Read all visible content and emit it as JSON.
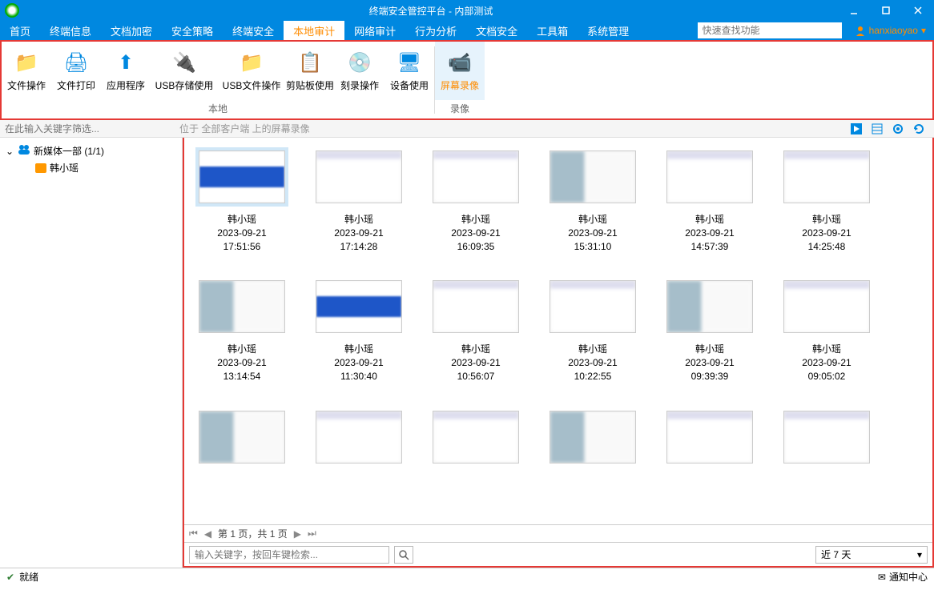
{
  "window": {
    "title": "终端安全管控平台 - 内部测试"
  },
  "menu": {
    "tabs": [
      "首页",
      "终端信息",
      "文档加密",
      "安全策略",
      "终端安全",
      "本地审计",
      "网络审计",
      "行为分析",
      "文档安全",
      "工具箱",
      "系统管理"
    ],
    "active_index": 5,
    "search_placeholder": "快速查找功能",
    "user": "hanxiaoyao"
  },
  "ribbon": {
    "group1_label": "本地",
    "group2_label": "录像",
    "items": [
      "文件操作",
      "文件打印",
      "应用程序",
      "USB存储使用",
      "USB文件操作",
      "剪贴板使用",
      "刻录操作",
      "设备使用",
      "屏幕录像"
    ],
    "active_index": 8
  },
  "filter": {
    "placeholder": "在此输入关键字筛选...",
    "breadcrumb": "位于 全部客户端 上的屏幕录像"
  },
  "tree": {
    "group": "新媒体一部 (1/1)",
    "leaf": "韩小瑶"
  },
  "recordings": [
    {
      "user": "韩小瑶",
      "date": "2023-09-21",
      "time": "17:51:56",
      "thumb": "t1",
      "selected": true
    },
    {
      "user": "韩小瑶",
      "date": "2023-09-21",
      "time": "17:14:28",
      "thumb": "t2"
    },
    {
      "user": "韩小瑶",
      "date": "2023-09-21",
      "time": "16:09:35",
      "thumb": "t2"
    },
    {
      "user": "韩小瑶",
      "date": "2023-09-21",
      "time": "15:31:10",
      "thumb": "t3"
    },
    {
      "user": "韩小瑶",
      "date": "2023-09-21",
      "time": "14:57:39",
      "thumb": "t2"
    },
    {
      "user": "韩小瑶",
      "date": "2023-09-21",
      "time": "14:25:48",
      "thumb": "t2"
    },
    {
      "user": "韩小瑶",
      "date": "2023-09-21",
      "time": "13:14:54",
      "thumb": "t3"
    },
    {
      "user": "韩小瑶",
      "date": "2023-09-21",
      "time": "11:30:40",
      "thumb": "t1"
    },
    {
      "user": "韩小瑶",
      "date": "2023-09-21",
      "time": "10:56:07",
      "thumb": "t2"
    },
    {
      "user": "韩小瑶",
      "date": "2023-09-21",
      "time": "10:22:55",
      "thumb": "t2"
    },
    {
      "user": "韩小瑶",
      "date": "2023-09-21",
      "time": "09:39:39",
      "thumb": "t3"
    },
    {
      "user": "韩小瑶",
      "date": "2023-09-21",
      "time": "09:05:02",
      "thumb": "t2"
    },
    {
      "user": "",
      "date": "",
      "time": "",
      "thumb": "t3"
    },
    {
      "user": "",
      "date": "",
      "time": "",
      "thumb": "t2"
    },
    {
      "user": "",
      "date": "",
      "time": "",
      "thumb": "t2"
    },
    {
      "user": "",
      "date": "",
      "time": "",
      "thumb": "t3"
    },
    {
      "user": "",
      "date": "",
      "time": "",
      "thumb": "t2"
    },
    {
      "user": "",
      "date": "",
      "time": "",
      "thumb": "t2"
    }
  ],
  "pager": {
    "text": "第 1 页，共 1 页"
  },
  "search": {
    "placeholder": "输入关键字，按回车键检索...",
    "range": "近 7 天"
  },
  "status": {
    "ready": "就绪",
    "notify": "通知中心"
  }
}
